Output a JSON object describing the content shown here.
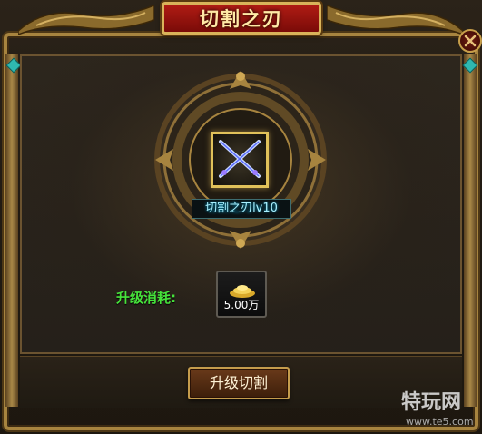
{
  "window": {
    "title": "切割之刃",
    "close_icon": "close-icon"
  },
  "skill": {
    "name": "切割之刃lv10",
    "icon": "crossed-swords-icon"
  },
  "cost": {
    "label": "升级消耗:",
    "value": "5.00万",
    "icon": "gold-coins-icon"
  },
  "actions": {
    "upgrade_label": "升级切割"
  },
  "watermark": {
    "text": "特玩网",
    "url": "www.te5.com"
  },
  "colors": {
    "cost_label": "#46e33b",
    "skill_name": "#a8f0ff",
    "title": "#ffe9a6",
    "frame_gold": "#a7843f"
  }
}
